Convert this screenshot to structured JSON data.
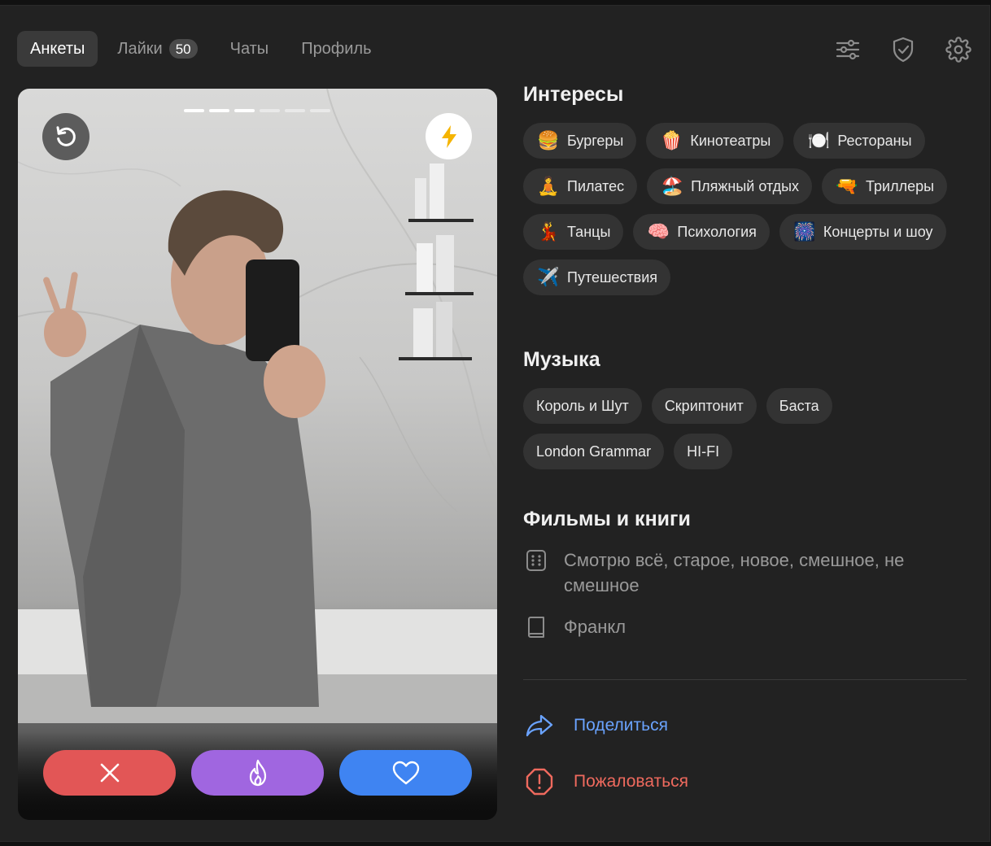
{
  "nav": {
    "tabs": [
      {
        "label": "Анкеты"
      },
      {
        "label": "Лайки",
        "badge": "50"
      },
      {
        "label": "Чаты"
      },
      {
        "label": "Профиль"
      }
    ]
  },
  "interests": {
    "title": "Интересы",
    "items": [
      {
        "emoji": "🍔",
        "label": "Бургеры"
      },
      {
        "emoji": "🍿",
        "label": "Кинотеатры"
      },
      {
        "emoji": "🍽️",
        "label": "Рестораны"
      },
      {
        "emoji": "🧘",
        "label": "Пилатес"
      },
      {
        "emoji": "🏖️",
        "label": "Пляжный отдых"
      },
      {
        "emoji": "🔫",
        "label": "Триллеры"
      },
      {
        "emoji": "💃",
        "label": "Танцы"
      },
      {
        "emoji": "🧠",
        "label": "Психология"
      },
      {
        "emoji": "🎆",
        "label": "Концерты и шоу"
      },
      {
        "emoji": "✈️",
        "label": "Путешествия"
      }
    ]
  },
  "music": {
    "title": "Музыка",
    "items": [
      "Король и Шут",
      "Скриптонит",
      "Баста",
      "London Grammar",
      "HI-FI"
    ]
  },
  "films": {
    "title": "Фильмы и книги",
    "movies": "Смотрю всё, старое, новое, смешное, не смешное",
    "books": "Франкл"
  },
  "actions": {
    "share": "Поделиться",
    "report": "Пожаловаться"
  },
  "photo": {
    "count": 6,
    "viewed": 3
  },
  "colors": {
    "dislike": "#e25656",
    "superlike": "#a066e0",
    "like": "#3f84f2",
    "share": "#6aa3ff",
    "report": "#ef6a5e",
    "boost": "#f5b400"
  }
}
